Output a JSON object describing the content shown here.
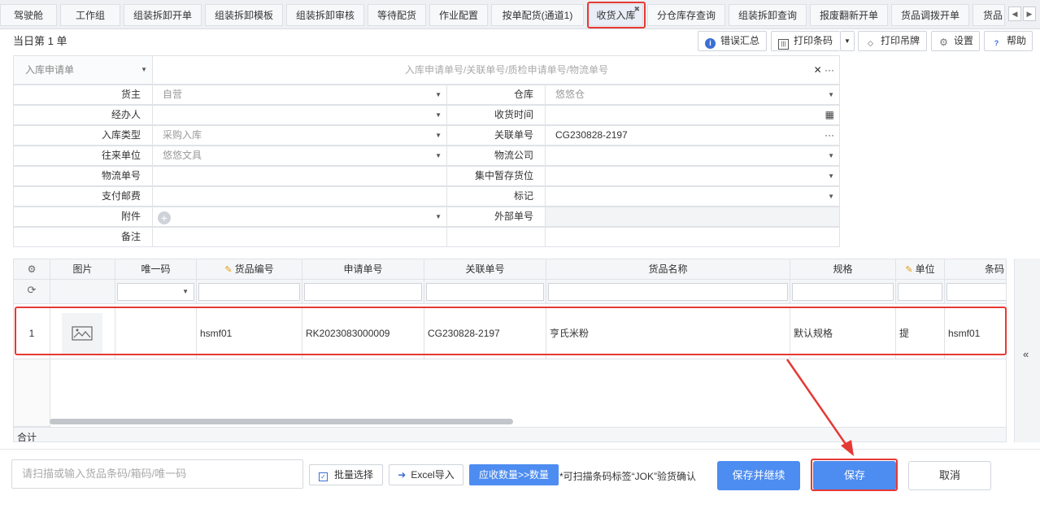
{
  "tabs": [
    {
      "label": "驾驶舱"
    },
    {
      "label": "工作组"
    },
    {
      "label": "组装拆卸开单"
    },
    {
      "label": "组装拆卸模板"
    },
    {
      "label": "组装拆卸审核"
    },
    {
      "label": "等待配货"
    },
    {
      "label": "作业配置"
    },
    {
      "label": "按单配货(通道1)"
    },
    {
      "label": "收货入库",
      "active": true
    },
    {
      "label": "分仓库存查询"
    },
    {
      "label": "组装拆卸查询"
    },
    {
      "label": "报废翻新开单"
    },
    {
      "label": "货品调拨开单"
    },
    {
      "label": "货品"
    }
  ],
  "page": {
    "subtitle": "当日第 1 单"
  },
  "toolbar": {
    "error_summary": "错误汇总",
    "print_barcode": "打印条码",
    "print_tag": "打印吊牌",
    "settings": "设置",
    "help": "帮助"
  },
  "form": {
    "doc_type": "入库申请单",
    "search_placeholder": "入库申请单号/关联单号/质检申请单号/物流单号",
    "fields_left": [
      {
        "label": "货主",
        "value": "自营"
      },
      {
        "label": "经办人",
        "value": ""
      },
      {
        "label": "入库类型",
        "value": "采购入库"
      },
      {
        "label": "往来单位",
        "value": "悠悠文具"
      },
      {
        "label": "物流单号",
        "value": ""
      },
      {
        "label": "支付邮费",
        "value": ""
      },
      {
        "label": "附件",
        "value": ""
      },
      {
        "label": "备注",
        "value": ""
      }
    ],
    "fields_right": [
      {
        "label": "仓库",
        "value": "悠悠仓"
      },
      {
        "label": "收货时间",
        "value": ""
      },
      {
        "label": "关联单号",
        "value": "CG230828-2197"
      },
      {
        "label": "物流公司",
        "value": ""
      },
      {
        "label": "集中暂存货位",
        "value": ""
      },
      {
        "label": "标记",
        "value": ""
      },
      {
        "label": "外部单号",
        "value": ""
      }
    ]
  },
  "grid": {
    "columns": [
      "图片",
      "唯一码",
      "货品编号",
      "申请单号",
      "关联单号",
      "货品名称",
      "规格",
      "单位",
      "条码"
    ],
    "rows": [
      {
        "index": "1",
        "unique_code": "",
        "goods_no": "hsmf01",
        "apply_no": "RK2023083000009",
        "related_no": "CG230828-2197",
        "goods_name": "亨氏米粉",
        "spec": "默认规格",
        "unit": "提",
        "barcode": "hsmf01"
      }
    ],
    "total_label": "合计"
  },
  "bottom": {
    "scan_placeholder": "请扫描或输入货品条码/箱码/唯一码",
    "batch_select": "批量选择",
    "excel_import": "Excel导入",
    "receive_qty": "应收数量>>数量",
    "hint": "*可扫描条码标签“JOK”验货确认",
    "save_continue": "保存并继续",
    "save": "保存",
    "cancel": "取消"
  },
  "colors": {
    "primary": "#4d8cf0",
    "highlight": "#e53935"
  }
}
